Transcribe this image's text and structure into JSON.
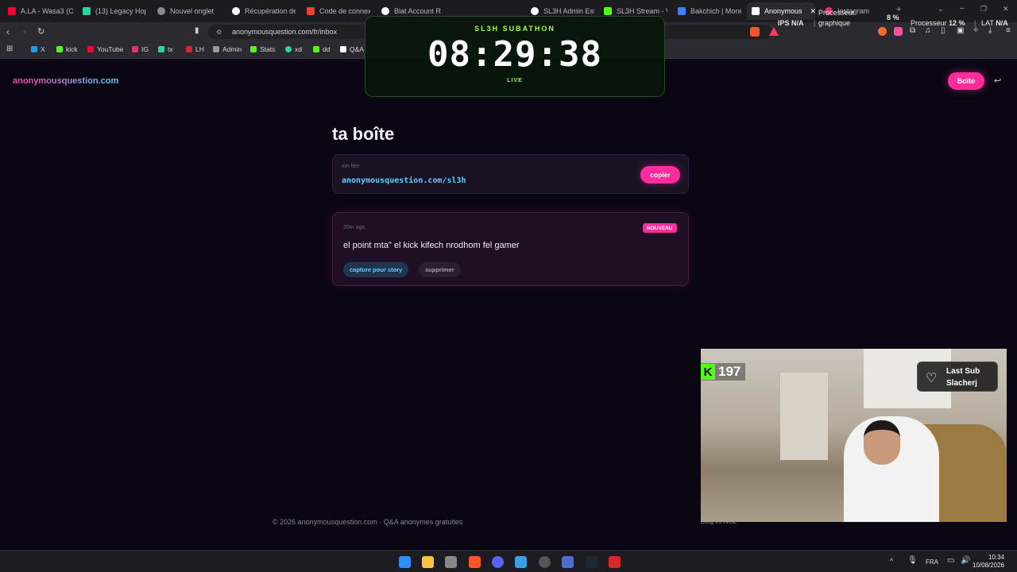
{
  "browser": {
    "tabs": [
      {
        "label": "A.LA - Wasa3 (O",
        "color": "#ff0033"
      },
      {
        "label": "(13) Legacy Hop",
        "color": "#2bd4a4"
      },
      {
        "label": "Nouvel onglet",
        "color": "#8a8a8a"
      },
      {
        "label": "Récupération de",
        "color": "#ffffff"
      },
      {
        "label": "Code de connex",
        "color": "#ea4335"
      },
      {
        "label": "Blat Account R",
        "color": "#ffffff"
      },
      {
        "label": "SL3H Admin Est",
        "color": "#ffffff"
      },
      {
        "label": "SL3H Stream - V",
        "color": "#53fc18"
      },
      {
        "label": "Bakchich | Moné",
        "color": "#3b82f6"
      },
      {
        "label": "Anonymous",
        "color": "#ffffff"
      },
      {
        "label": "Instagram",
        "color": "#e1306c"
      }
    ],
    "url": "anonymousquestion.com/fr/inbox",
    "bookmarks": [
      {
        "label": "X",
        "color": "#1d9bf0"
      },
      {
        "label": "kick",
        "color": "#53fc18"
      },
      {
        "label": "YouTube",
        "color": "#ff0033"
      },
      {
        "label": "IG",
        "color": "#e1306c"
      },
      {
        "label": "tx",
        "color": "#2bd4a4"
      },
      {
        "label": "LH",
        "color": "#d62828"
      },
      {
        "label": "Admin",
        "color": "#999999"
      },
      {
        "label": "Stats",
        "color": "#53fc18"
      },
      {
        "label": "xd",
        "color": "#2bd4a4"
      },
      {
        "label": "dd",
        "color": "#53fc18"
      },
      {
        "label": "Q&A",
        "color": "#ffffff"
      }
    ]
  },
  "site": {
    "logo": "anonymousquestion.com",
    "box_button": "Boîte",
    "logout_icon": "↩",
    "heading": "ta boîte",
    "link_card": {
      "label": "ton lien",
      "url": "anonymousquestion.com/sl3h",
      "copy_button": "copier"
    },
    "message": {
      "time": "20m ago",
      "badge": "NOUVEAU",
      "text": "el point mta\" el kick  kifech nrodhom fel gamer",
      "story_button": "capture pour story",
      "delete_button": "supprimer"
    },
    "footer": "© 2026 anonymousquestion.com · Q&A anonymes gratuites",
    "footer_links": "Blog   vs NGL"
  },
  "overlay": {
    "timer_title": "SL3H SUBATHON",
    "timer_value": "08:29:38",
    "timer_status": "LIVE",
    "stats": {
      "fps_label": "IPS",
      "fps_value": "N/A",
      "gpu_label": "graphique",
      "cpu_label": "Processeur",
      "cpu_top_value": "8 %",
      "cpu_value": "12 %",
      "lat_label": "LAT",
      "lat_value": "N/A",
      "proc_label_top": "Processeur"
    },
    "kick_count": "197",
    "last_sub_title": "Last Sub",
    "last_sub_name": "Slacherj"
  },
  "taskbar": {
    "lang": "FRA",
    "time": "10:34",
    "date": "10/08/2026"
  }
}
